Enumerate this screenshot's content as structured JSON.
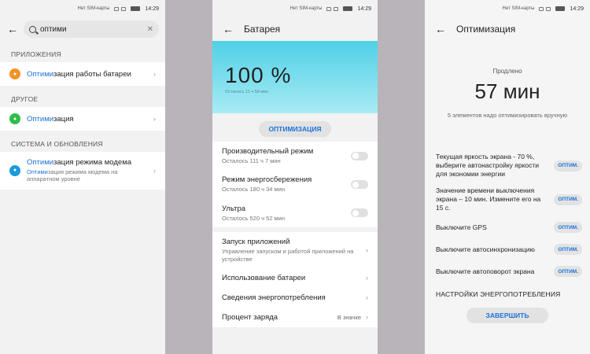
{
  "status": {
    "sim": "Нет SIM-карты",
    "time": "14:29"
  },
  "search_screen": {
    "query": "оптими",
    "sections": [
      {
        "label": "ПРИЛОЖЕНИЯ",
        "item": {
          "hl": "Оптими",
          "rest": "зация работы батареи",
          "sub_hl": "",
          "sub_rest": "",
          "icon": "apps-icon",
          "color": "#f2932a"
        }
      },
      {
        "label": "ДРУГОЕ",
        "item": {
          "hl": "Оптими",
          "rest": "зация",
          "sub_hl": "",
          "sub_rest": "",
          "icon": "battery-icon",
          "color": "#2fbd4a"
        }
      },
      {
        "label": "СИСТЕМА И ОБНОВЛЕНИЯ",
        "item": {
          "hl": "Оптими",
          "rest": "зация режима модема",
          "sub_hl": "Оптими",
          "sub_rest": "зация режима модема на аппаратном уровне",
          "icon": "info-icon",
          "color": "#1a9ad9"
        }
      }
    ]
  },
  "battery_screen": {
    "title": "Батарея",
    "percent": "100 %",
    "remaining": "Осталось 11 ч 58 мин",
    "optimize_button": "ОПТИМИЗАЦИЯ",
    "modes": [
      {
        "title": "Производительный режим",
        "sub": "Осталось 111 ч 7 мин"
      },
      {
        "title": "Режим энергосбережения",
        "sub": "Осталось 180 ч 34 мин"
      },
      {
        "title": "Ультра",
        "sub": "Осталось 520 ч 52 мин"
      }
    ],
    "links": [
      {
        "title": "Запуск приложений",
        "sub": "Управление запуском и работой приложений на устройстве"
      },
      {
        "title": "Использование батареи",
        "sub": ""
      },
      {
        "title": "Сведения энергопотребления",
        "sub": ""
      }
    ],
    "charge": {
      "title": "Процент заряда",
      "value": "В значке"
    }
  },
  "optim_screen": {
    "title": "Оптимизация",
    "extend_label": "Продлено",
    "extend_value": "57 мин",
    "note": "5 элементов надо оптимизировать вручную",
    "items": [
      "Текущая яркость экрана - 70 %, выберите автонастройку яркости для экономии энергии",
      "Значение времени выключения экрана – 10 мин. Измените его на 15 с.",
      "Выключите GPS",
      "Выключите автосинхронизацию",
      "Выключите автоповорот экрана"
    ],
    "item_button": "ОПТИМ.",
    "energy_settings": "НАСТРОЙКИ ЭНЕРГОПОТРЕБЛЕНИЯ",
    "finish_button": "ЗАВЕРШИТЬ"
  },
  "colors": {
    "accent": "#1a73d9",
    "hero_top": "#4fd0e6",
    "hero_bottom": "#a9ebf4"
  }
}
